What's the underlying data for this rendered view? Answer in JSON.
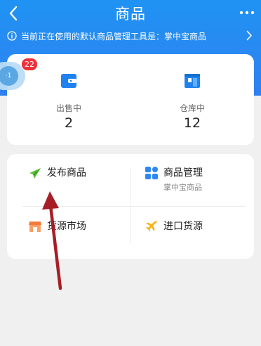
{
  "nav": {
    "title": "商品",
    "back_icon": "chevron-left-icon",
    "more_icon": "more-dots-icon"
  },
  "notice": {
    "text": "当前正在使用的默认商品管理工具是：掌中宝商品",
    "icon": "info-circle-icon"
  },
  "float_widget": {
    "badge_count": "22",
    "inner_text": "·1"
  },
  "stats": [
    {
      "label": "出售中",
      "value": "2",
      "icon": "wallet-icon",
      "color": "#1f82ee"
    },
    {
      "label": "仓库中",
      "value": "12",
      "icon": "warehouse-book-icon",
      "color": "#1f82ee"
    }
  ],
  "tools": {
    "publish": {
      "label": "发布商品",
      "icon": "paper-plane-icon",
      "color": "#5cc23a"
    },
    "manage": {
      "label": "商品管理",
      "sublabel": "掌中宝商品",
      "icon": "grid-tiles-icon",
      "color": "#2f87ee"
    },
    "market": {
      "label": "货源市场",
      "icon": "storefront-icon",
      "color": "#f47b3b"
    },
    "import": {
      "label": "进口货源",
      "icon": "airplane-icon",
      "color": "#f6b516"
    }
  },
  "colors": {
    "header": "#2b86f2",
    "annotation_arrow": "#a81e27"
  }
}
